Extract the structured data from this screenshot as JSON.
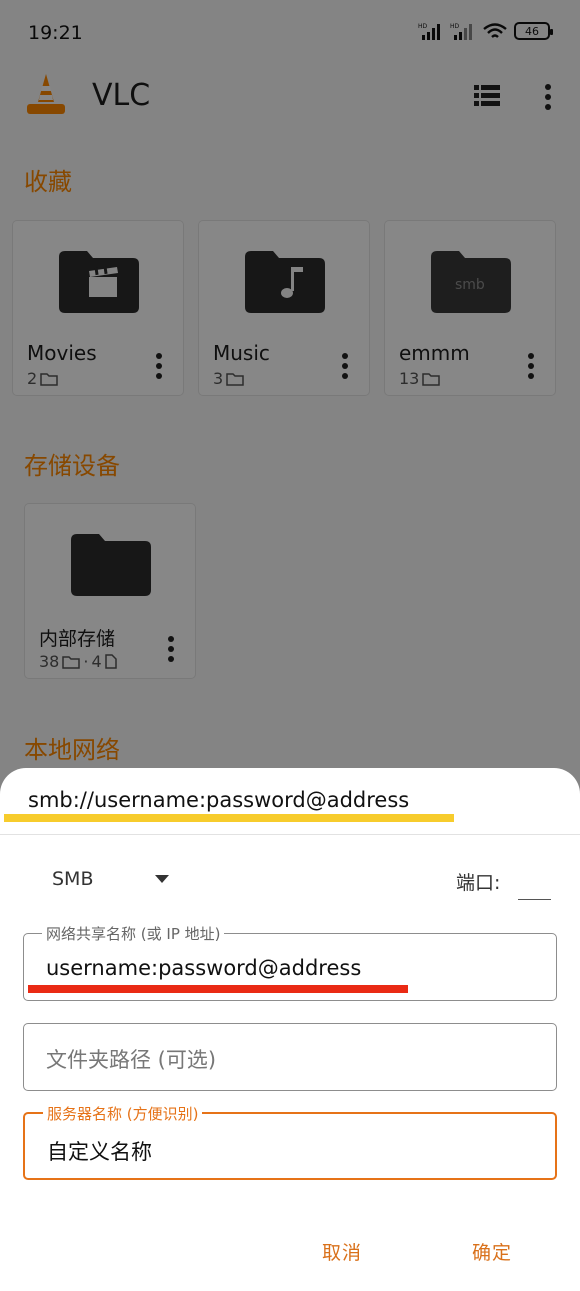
{
  "status_bar": {
    "time": "19:21",
    "battery": "46"
  },
  "app_bar": {
    "title": "VLC"
  },
  "sections": {
    "favorites": "收藏",
    "storage": "存储设备",
    "local_network": "本地网络"
  },
  "favorites": [
    {
      "name": "Movies",
      "count": "2",
      "icon": "movie-folder-icon"
    },
    {
      "name": "Music",
      "count": "3",
      "icon": "music-folder-icon"
    },
    {
      "name": "emmm",
      "count": "13",
      "icon": "smb-folder-icon",
      "badge": "smb"
    }
  ],
  "storage_devices": [
    {
      "name": "内部存储",
      "folders": "38",
      "separator": "·",
      "files": "4"
    }
  ],
  "dialog": {
    "url_hint": "smb://username:password@address",
    "protocol": "SMB",
    "port_label": "端口:",
    "port_value": "",
    "share_name_label": "网络共享名称 (或 IP 地址)",
    "share_name_value": "username:password@address",
    "folder_path_placeholder": "文件夹路径 (可选)",
    "server_name_label": "服务器名称 (方便识别)",
    "server_name_value": "自定义名称",
    "cancel": "取消",
    "ok": "确定"
  },
  "colors": {
    "accent": "#ff8800",
    "button": "#d9711b",
    "highlight_yellow": "#f7cc2c",
    "highlight_red": "#ea2a14"
  }
}
